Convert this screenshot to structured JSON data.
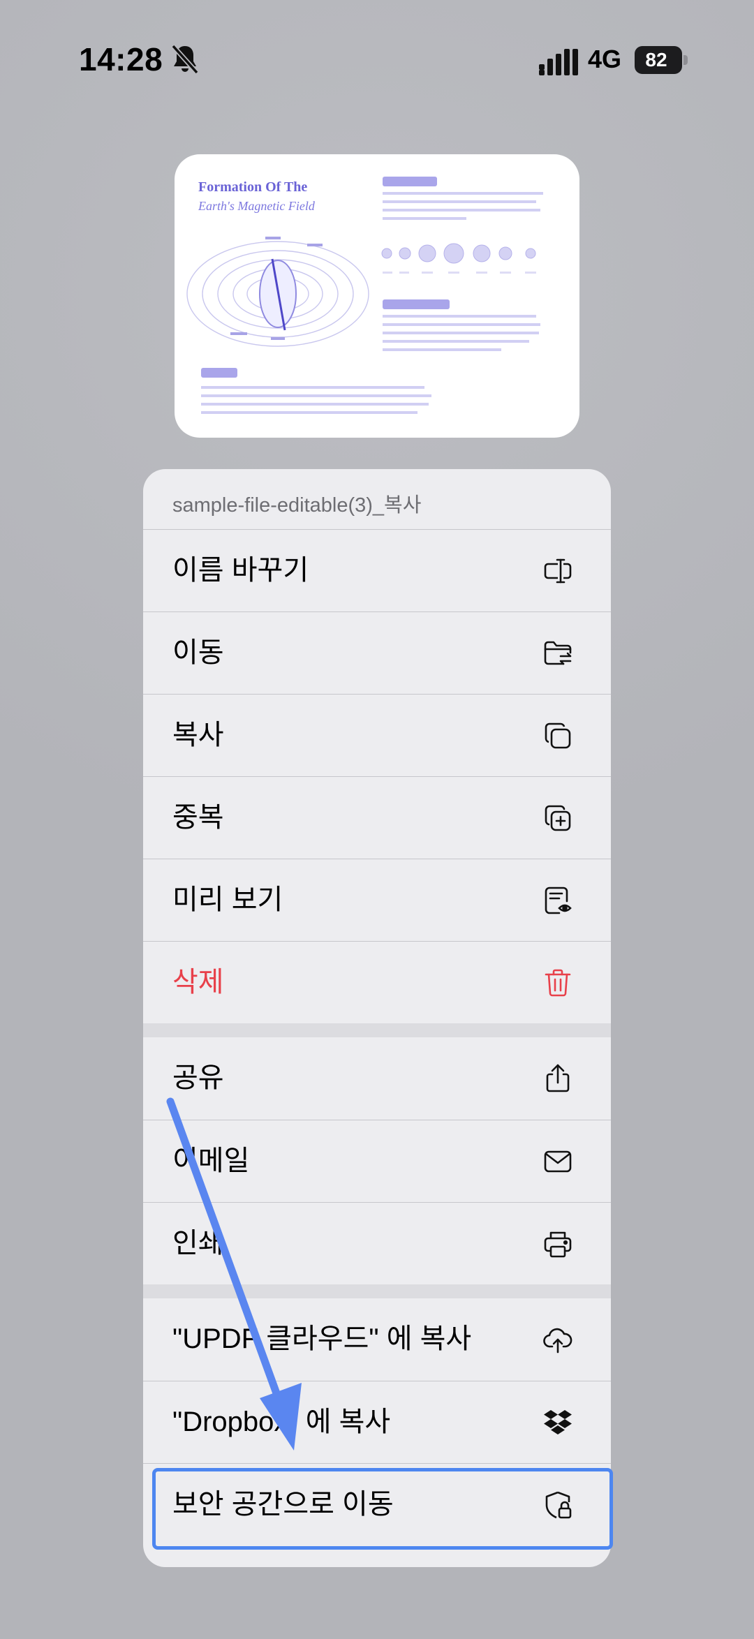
{
  "status_bar": {
    "time": "14:28",
    "network": "4G",
    "battery": "82"
  },
  "preview": {
    "title": "Formation Of The",
    "subtitle": "Earth's Magnetic Field"
  },
  "menu": {
    "header": "sample-file-editable(3)_복사",
    "items": [
      {
        "label": "이름 바꾸기",
        "icon": "rename-icon"
      },
      {
        "label": "이동",
        "icon": "folder-move-icon"
      },
      {
        "label": "복사",
        "icon": "copy-icon"
      },
      {
        "label": "중복",
        "icon": "duplicate-icon"
      },
      {
        "label": "미리 보기",
        "icon": "preview-icon"
      },
      {
        "label": "삭제",
        "icon": "trash-icon"
      },
      {
        "label": "공유",
        "icon": "share-icon"
      },
      {
        "label": "이메일",
        "icon": "mail-icon"
      },
      {
        "label": "인쇄",
        "icon": "print-icon"
      },
      {
        "label": "\"UPDF 클라우드\" 에 복사",
        "icon": "cloud-upload-icon"
      },
      {
        "label": "\"Dropbox\" 에 복사",
        "icon": "dropbox-icon"
      },
      {
        "label": "보안 공간으로 이동",
        "icon": "secure-space-icon"
      }
    ]
  },
  "colors": {
    "danger": "#e8404a",
    "highlight": "#4d86f0",
    "arrow": "#5a86f0"
  }
}
